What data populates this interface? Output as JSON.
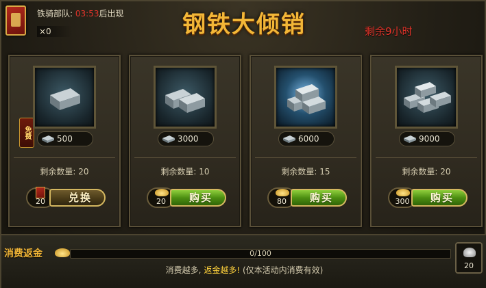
{
  "header": {
    "troop_label": "铁骑部队:",
    "troop_time": "03:53",
    "troop_suffix": "后出现",
    "ticket_count": "×0",
    "title": "钢铁大倾销",
    "remaining": "剩余9小时"
  },
  "colors": {
    "title_gold": "#f2b637",
    "alert_red": "#e2342a",
    "buy_green": "#4d8f12",
    "frame_bronze": "#5a5038"
  },
  "free_tag": "免费",
  "cards": [
    {
      "icon": "iron-ingot-pile-small-icon",
      "price": "500",
      "stock": "剩余数量: 20",
      "cost": "20",
      "cost_icon": "red-token-icon",
      "button": "兑换"
    },
    {
      "icon": "iron-ingot-pile-medium-icon",
      "price": "3000",
      "stock": "剩余数量: 10",
      "cost": "20",
      "cost_icon": "gold-ingot-icon",
      "button": "购买"
    },
    {
      "icon": "iron-ingot-pile-large-icon",
      "price": "6000",
      "stock": "剩余数量: 15",
      "cost": "80",
      "cost_icon": "gold-ingot-icon",
      "button": "购买"
    },
    {
      "icon": "iron-ingot-pile-huge-icon",
      "price": "9000",
      "stock": "剩余数量: 20",
      "cost": "300",
      "cost_icon": "gold-ingot-icon",
      "button": "购买"
    }
  ],
  "rebate": {
    "label": "消费返金",
    "progress_text": "0/100",
    "progress_fraction": 0,
    "notice_prefix": "消费越多, ",
    "notice_highlight": "返金越多!",
    "notice_suffix": " (仅本活动内消费有效)",
    "reward_count": "20"
  }
}
